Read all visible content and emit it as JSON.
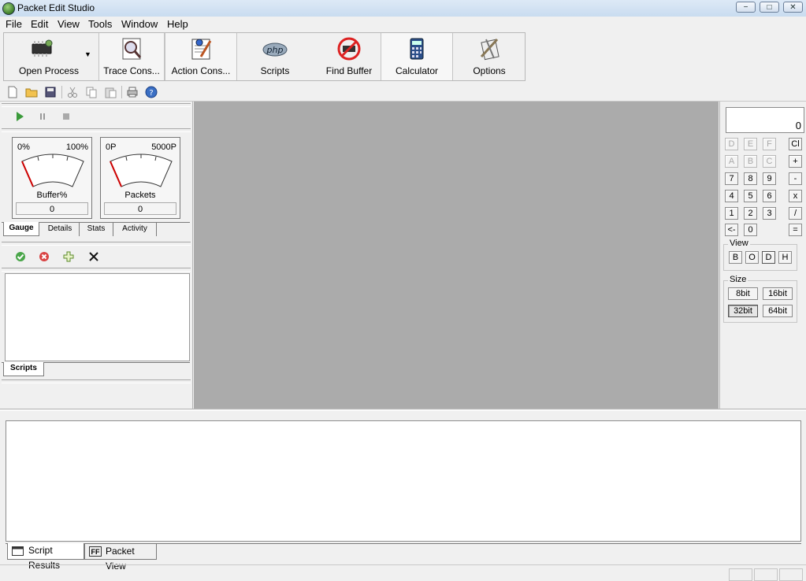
{
  "window": {
    "title": "Packet Edit Studio",
    "minimize": "−",
    "maximize": "□",
    "close": "✕"
  },
  "menu": [
    "File",
    "Edit",
    "View",
    "Tools",
    "Window",
    "Help"
  ],
  "big_toolbar": [
    {
      "label": "Open Process",
      "icon": "chip-icon"
    },
    {
      "label": "Trace Cons...",
      "icon": "trace-icon"
    },
    {
      "label": "Action Cons...",
      "icon": "action-icon"
    },
    {
      "label": "Scripts",
      "icon": "php-icon"
    },
    {
      "label": "Find Buffer",
      "icon": "find-buffer-icon"
    },
    {
      "label": "Calculator",
      "icon": "calculator-icon"
    },
    {
      "label": "Options",
      "icon": "options-icon"
    }
  ],
  "gauges": [
    {
      "name": "Buffer%",
      "min": "0%",
      "max": "100%",
      "value": "0"
    },
    {
      "name": "Packets",
      "min": "0P",
      "max": "5000P",
      "value": "0"
    }
  ],
  "gauge_tabs": [
    "Gauge",
    "Details",
    "Stats",
    "Activity"
  ],
  "script_tabs": [
    "Scripts"
  ],
  "calculator": {
    "display": "0",
    "row1": [
      "D",
      "E",
      "F",
      "Cl"
    ],
    "row2": [
      "A",
      "B",
      "C",
      "+"
    ],
    "row3": [
      "7",
      "8",
      "9",
      "-"
    ],
    "row4": [
      "4",
      "5",
      "6",
      "x"
    ],
    "row5": [
      "1",
      "2",
      "3",
      "/"
    ],
    "row6": [
      "<-",
      "0",
      "="
    ],
    "view_title": "View",
    "view_buttons": [
      "B",
      "O",
      "D",
      "H"
    ],
    "size_title": "Size",
    "size_buttons": [
      "8bit",
      "16bit",
      "32bit",
      "64bit"
    ],
    "selected_size": "32bit"
  },
  "bottom_tabs": [
    "Script Results",
    "Packet View"
  ],
  "packet_view_icon_text": "FF",
  "colors": {
    "workspace": "#ababab",
    "titlebar": "#dde9f6"
  }
}
